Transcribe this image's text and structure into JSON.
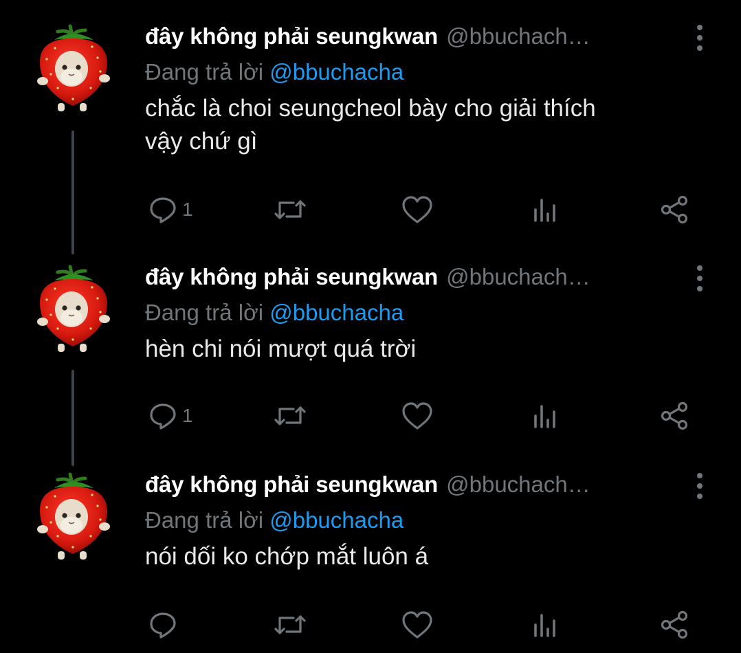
{
  "tweets": [
    {
      "display_name": "đây không phải seungkwan",
      "handle": "@bbuchach…",
      "reply_prefix": "Đang trả lời",
      "reply_to": "@bbuchacha",
      "text_lines": [
        "chắc là choi seungcheol bày cho giải thích",
        "vậy chứ gì"
      ],
      "reply_count": "1"
    },
    {
      "display_name": "đây không phải seungkwan",
      "handle": "@bbuchach…",
      "reply_prefix": "Đang trả lời",
      "reply_to": "@bbuchacha",
      "text_lines": [
        "hèn chi nói mượt quá trời"
      ],
      "reply_count": "1"
    },
    {
      "display_name": "đây không phải seungkwan",
      "handle": "@bbuchach…",
      "reply_prefix": "Đang trả lời",
      "reply_to": "@bbuchacha",
      "text_lines": [
        "nói dối ko chớp mắt luôn á"
      ],
      "reply_count": ""
    }
  ],
  "colors": {
    "background": "#000000",
    "name": "#ffffff",
    "muted": "#71767b",
    "mention": "#1d9bf0",
    "thread_line": "#3d4349"
  },
  "icons": [
    "reply-icon",
    "retweet-icon",
    "like-icon",
    "views-icon",
    "share-icon",
    "more-icon",
    "avatar-strawberry-cat"
  ]
}
